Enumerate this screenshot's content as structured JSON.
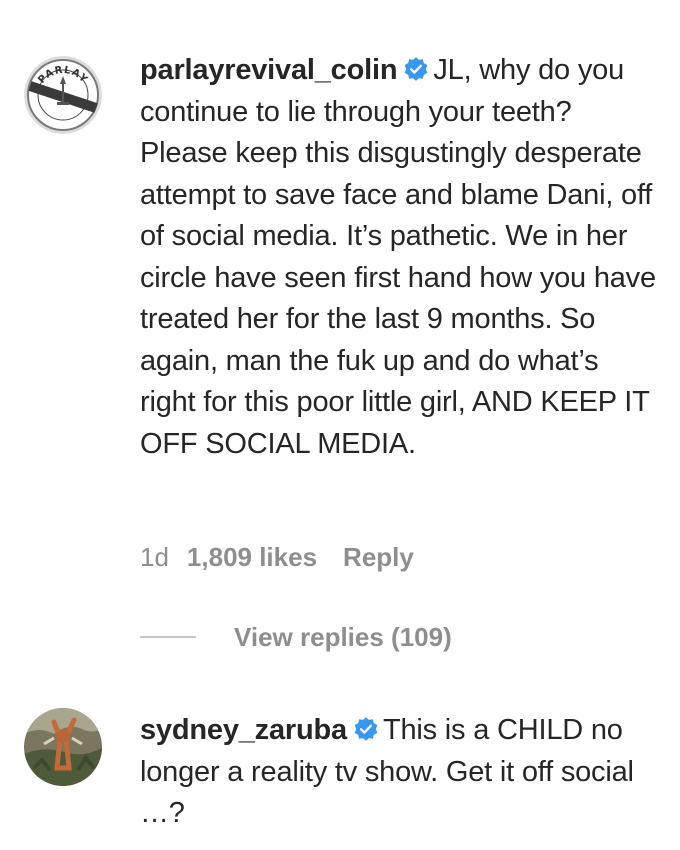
{
  "comments": [
    {
      "username": "parlayrevival_colin",
      "verified": true,
      "text": "JL, why do you continue to lie through your teeth? Please keep this disgustingly desperate attempt to save face and blame Dani, off of social media. It’s pathetic. We in her circle have seen first hand how you have treated her for the last 9 months. So again, man the fuk up and do what’s right for this poor little girl, AND KEEP IT OFF SOCIAL MEDIA.",
      "avatar_icon": "parlay-revival-logo-avatar",
      "avatar_logo_text_top": "PARLAY",
      "avatar_logo_text_bottom": "REVIVAL",
      "time": "1d",
      "likes": "1,809 likes",
      "reply_label": "Reply",
      "view_replies": "View replies (109)"
    },
    {
      "username": "sydney_zaruba",
      "verified": true,
      "text": "This is a CHILD no longer a reality tv show. Get it off social …?",
      "avatar_icon": "photo-avatar"
    }
  ],
  "colors": {
    "text": "#262626",
    "secondary": "#8e8e8e",
    "verified_badge": "#3897f0"
  }
}
